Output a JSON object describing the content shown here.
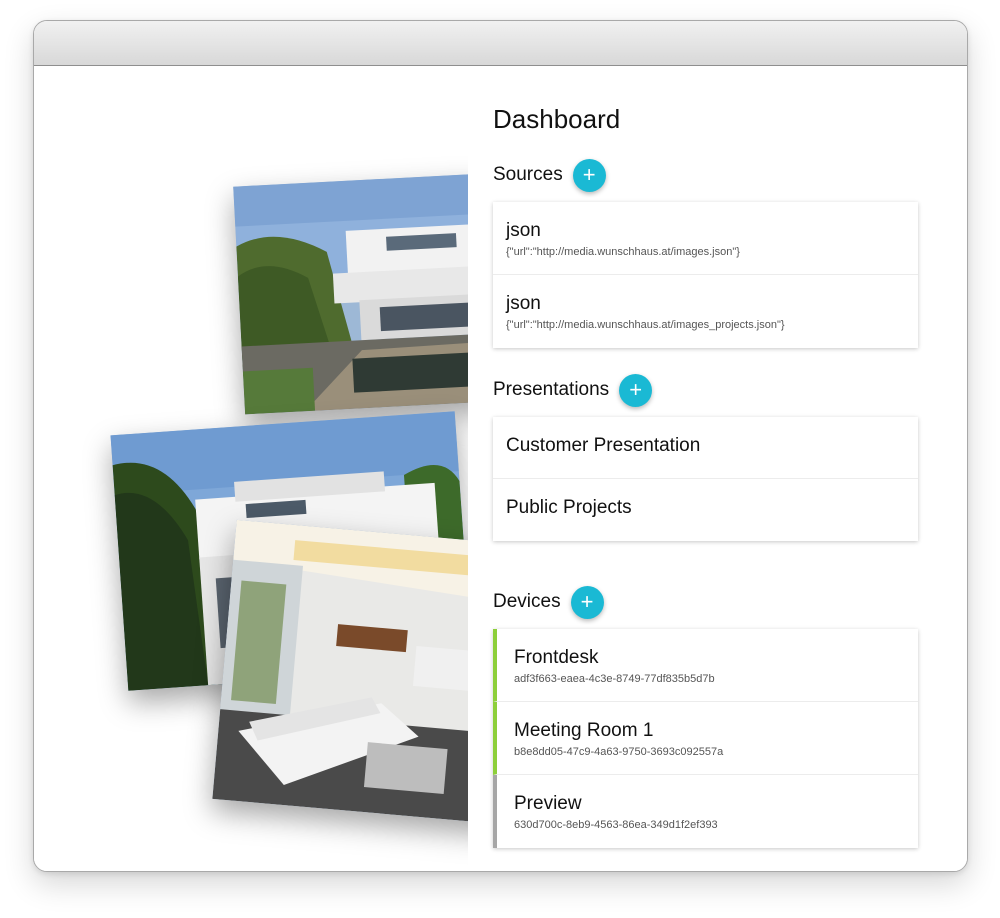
{
  "dashboard": {
    "title": "Dashboard",
    "sources": {
      "title": "Sources",
      "add_label": "+",
      "items": [
        {
          "name": "json",
          "config": "{\"url\":\"http://media.wunschhaus.at/images.json\"}"
        },
        {
          "name": "json",
          "config": "{\"url\":\"http://media.wunschhaus.at/images_projects.json\"}"
        }
      ]
    },
    "presentations": {
      "title": "Presentations",
      "add_label": "+",
      "items": [
        {
          "name": "Customer Presentation"
        },
        {
          "name": "Public Projects"
        }
      ]
    },
    "devices": {
      "title": "Devices",
      "add_label": "+",
      "items": [
        {
          "name": "Frontdesk",
          "id": "adf3f663-eaea-4c3e-8749-77df835b5d7b",
          "status_color": "#8dcf3a"
        },
        {
          "name": "Meeting Room 1",
          "id": "b8e8dd05-47c9-4a63-9750-3693c092557a",
          "status_color": "#8dcf3a"
        },
        {
          "name": "Preview",
          "id": "630d700c-8eb9-4563-86ea-349d1f2ef393",
          "status_color": "#a6a6a6"
        }
      ]
    }
  },
  "colors": {
    "accent": "#1ab9d4",
    "device_active": "#8dcf3a",
    "device_inactive": "#a6a6a6"
  },
  "photos": [
    {
      "icon": "house-exterior-pool-photo"
    },
    {
      "icon": "house-exterior-photo"
    },
    {
      "icon": "living-room-photo"
    }
  ]
}
